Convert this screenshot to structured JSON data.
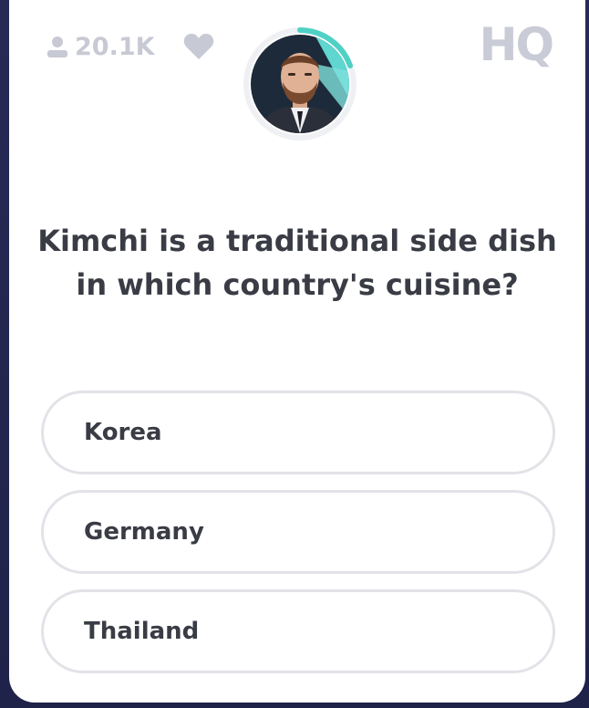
{
  "header": {
    "viewer_count": "20.1K",
    "logo_text": "HQ"
  },
  "question": {
    "text": "Kimchi is a traditional side dish in which country's cuisine?"
  },
  "answers": [
    {
      "label": "Korea"
    },
    {
      "label": "Germany"
    },
    {
      "label": "Thailand"
    }
  ],
  "colors": {
    "background": "#272a55",
    "card": "#ffffff",
    "muted_gray": "#c7c9d4",
    "text_dark": "#3a3c45",
    "timer_teal": "#4fd1c5",
    "answer_border": "#e2e3e8"
  },
  "icons": {
    "viewers": "person-icon",
    "heart": "heart-icon"
  }
}
